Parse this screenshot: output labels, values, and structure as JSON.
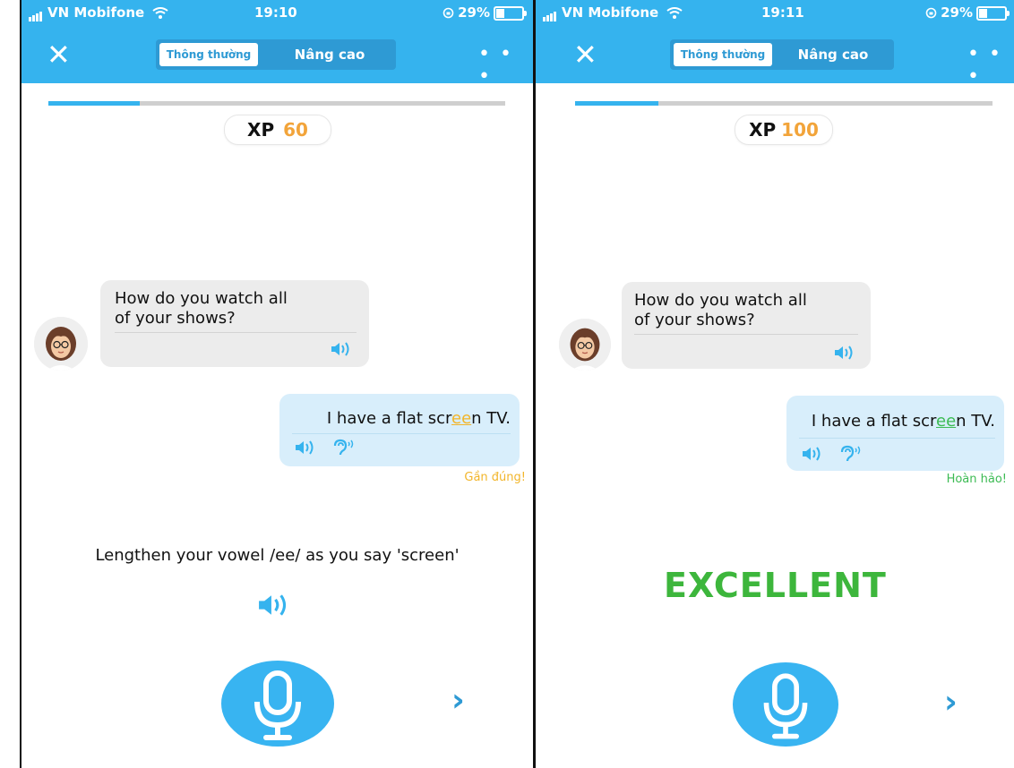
{
  "screens": [
    {
      "status": {
        "carrier": "VN Mobifone",
        "time": "19:10",
        "battery": "29%"
      },
      "header": {
        "close_glyph": "✕",
        "tab_normal": "Thông thường",
        "tab_advanced": "Nâng cao",
        "more_glyph": "• • •"
      },
      "progress": 0.2,
      "xp": {
        "label": "XP",
        "value": "60"
      },
      "question": {
        "line1": "How do you watch all",
        "line2": "of your shows?"
      },
      "answer": {
        "before": "I have a flat scr",
        "highlight": "ee",
        "after": "n TV."
      },
      "feedback": "Gần đúng!",
      "tip": "Lengthen your vowel /ee/ as you say 'screen'",
      "next_glyph": "›"
    },
    {
      "status": {
        "carrier": "VN Mobifone",
        "time": "19:11",
        "battery": "29%"
      },
      "header": {
        "close_glyph": "✕",
        "tab_normal": "Thông thường",
        "tab_advanced": "Nâng cao",
        "more_glyph": "• • •"
      },
      "progress": 0.2,
      "xp": {
        "label": "XP",
        "value": "100"
      },
      "question": {
        "line1": "How do you watch all",
        "line2": "of your shows?"
      },
      "answer": {
        "before": "I have a flat scr",
        "highlight": "ee",
        "after": "n TV."
      },
      "feedback": "Hoàn hảo!",
      "excellent": "EXCELLENT",
      "next_glyph": "›"
    }
  ],
  "colors": {
    "accent": "#35b3ee",
    "xp": "#f2a43a",
    "near": "#f2b52a",
    "perfect": "#3dbb54"
  }
}
